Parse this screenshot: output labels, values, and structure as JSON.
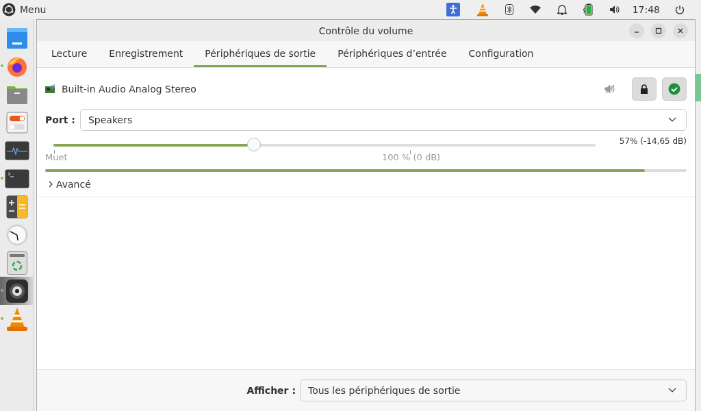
{
  "top_panel": {
    "menu_label": "Menu",
    "clock": "17:48"
  },
  "dock": [
    {
      "kind": "desktop",
      "running": false,
      "selected": false
    },
    {
      "kind": "firefox",
      "running": true,
      "selected": false
    },
    {
      "kind": "folder",
      "running": false,
      "selected": false
    },
    {
      "kind": "toggles",
      "running": false,
      "selected": false
    },
    {
      "kind": "monitor",
      "running": false,
      "selected": false
    },
    {
      "kind": "terminal",
      "running": true,
      "selected": false
    },
    {
      "kind": "calculator",
      "running": false,
      "selected": false
    },
    {
      "kind": "clock",
      "running": false,
      "selected": false
    },
    {
      "kind": "trash",
      "running": false,
      "selected": false
    },
    {
      "kind": "speaker",
      "running": true,
      "selected": true
    },
    {
      "kind": "cone",
      "running": true,
      "selected": false
    }
  ],
  "window": {
    "title": "Contrôle du volume"
  },
  "tabs": [
    {
      "label": "Lecture",
      "selected": false
    },
    {
      "label": "Enregistrement",
      "selected": false
    },
    {
      "label": "Périphériques de sortie",
      "selected": true
    },
    {
      "label": "Périphériques d’entrée",
      "selected": false
    },
    {
      "label": "Configuration",
      "selected": false
    }
  ],
  "device": {
    "name": "Built-in Audio Analog Stereo",
    "muted": false,
    "default": true
  },
  "port": {
    "label": "Port :",
    "value": "Speakers"
  },
  "volume": {
    "level": 0.37,
    "reading": "57% (-14,65 dB)",
    "min_label": "Muet",
    "mark_label": "100 % (0 dB)"
  },
  "meter": {
    "level": 0.935
  },
  "advanced": {
    "label": "Avancé",
    "expanded": false
  },
  "footer": {
    "label": "Afficher :",
    "value": "Tous les périphériques de sortie"
  }
}
